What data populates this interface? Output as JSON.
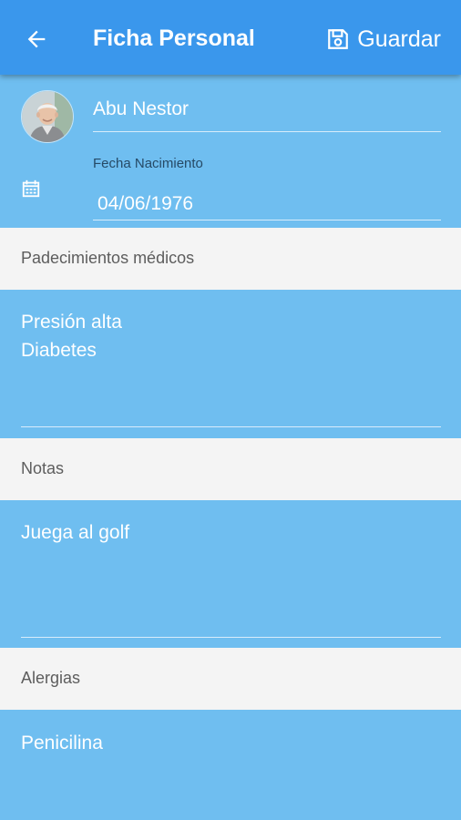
{
  "header": {
    "title": "Ficha Personal",
    "save_label": "Guardar"
  },
  "profile": {
    "name": "Abu Nestor",
    "birth_label": "Fecha Nacimiento",
    "birth_date": "04/06/1976"
  },
  "sections": [
    {
      "label": "Padecimientos médicos",
      "lines": [
        "Presión alta",
        "Diabetes"
      ]
    },
    {
      "label": "Notas",
      "lines": [
        "Juega al golf"
      ]
    },
    {
      "label": "Alergias",
      "lines": [
        "Penicilina"
      ]
    }
  ],
  "colors": {
    "appbar": "#3a97ec",
    "content": "#6fbef0",
    "section_bg": "#f4f4f4"
  }
}
